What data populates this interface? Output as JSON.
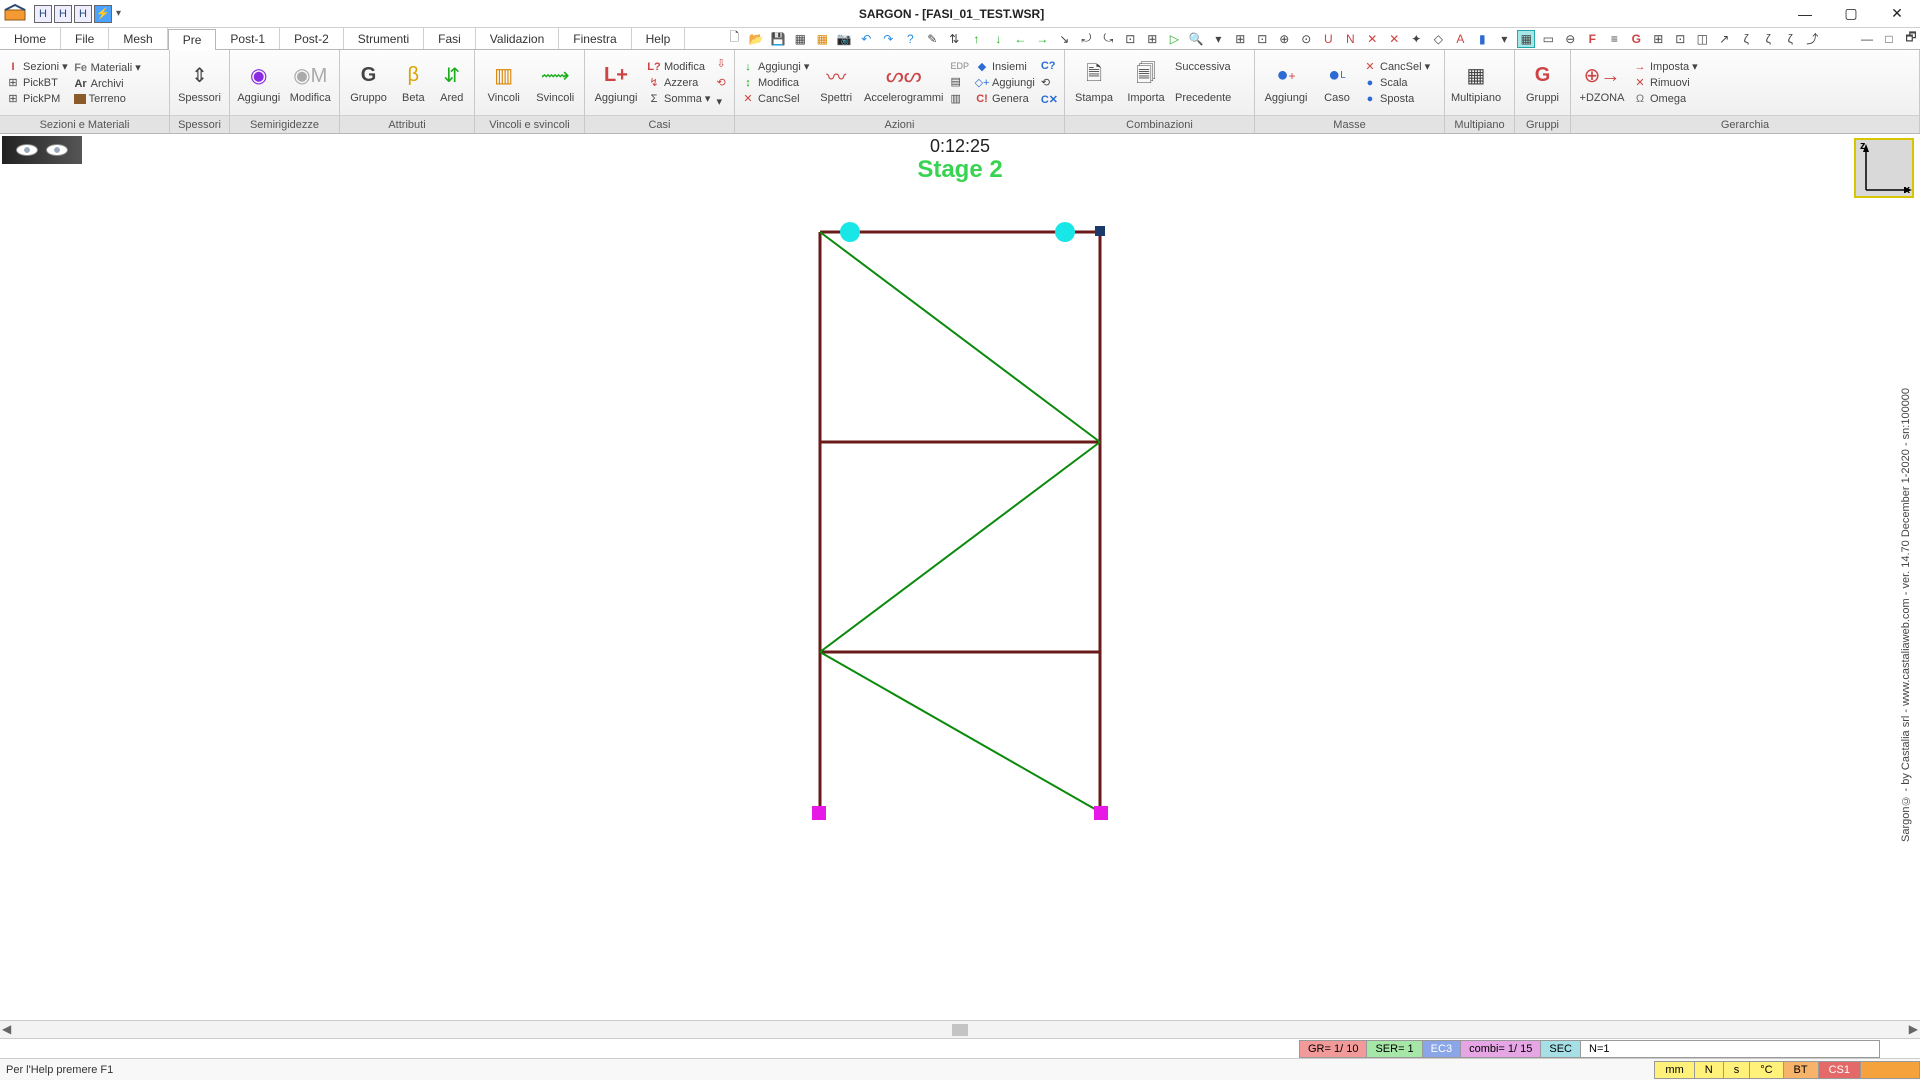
{
  "title": "SARGON - [FASI_01_TEST.WSR]",
  "qat": [
    "H",
    "H",
    "H",
    "⚡",
    "▾"
  ],
  "menus": [
    "Home",
    "File",
    "Mesh",
    "Pre",
    "Post-1",
    "Post-2",
    "Strumenti",
    "Fasi",
    "Validazion",
    "Finestra",
    "Help"
  ],
  "menu_active": "Pre",
  "ribbon": {
    "g1": {
      "label": "Sezioni e Materiali",
      "sezioni": "Sezioni",
      "materiali": "Materiali",
      "pickbt": "PickBT",
      "archivi": "Archivi",
      "pickpm": "PickPM",
      "terreno": "Terreno",
      "sez_pre": "I",
      "mat_pre": "Fe",
      "arc_pre": "Ar"
    },
    "g2": {
      "label": "Spessori",
      "btn": "Spessori"
    },
    "g3": {
      "label": "Semirigidezze",
      "aggiungi": "Aggiungi",
      "modifica": "Modifica"
    },
    "g4": {
      "label": "Attributi",
      "gruppo": "Gruppo",
      "beta": "Beta",
      "ared": "Ared"
    },
    "g5": {
      "label": "Vincoli e svincoli",
      "vincoli": "Vincoli",
      "svincoli": "Svincoli"
    },
    "g6": {
      "label": "Casi",
      "aggiungi": "Aggiungi",
      "modifica": "Modifica",
      "azzera": "Azzera",
      "somma": "Somma",
      "l_q": "L?",
      "sigma": "Σ"
    },
    "g7": {
      "label": "Azioni",
      "aggiungi": "Aggiungi",
      "modifica": "Modifica",
      "cancsel": "CancSel",
      "spettri": "Spettri",
      "accel": "Accelerogrammi",
      "insiemi": "Insiemi",
      "aggiungi2": "Aggiungi",
      "genera": "Genera",
      "edp": "EDP",
      "c_q": "C?",
      "c_bang": "C!",
      "c_cross": "C✕"
    },
    "g8": {
      "label": "Combinazioni",
      "stampa": "Stampa",
      "importa": "Importa",
      "succ": "Successiva",
      "prec": "Precedente"
    },
    "g9": {
      "label": "Masse",
      "aggiungi": "Aggiungi",
      "caso": "Caso",
      "cancsel": "CancSel",
      "scala": "Scala",
      "sposta": "Sposta"
    },
    "g10": {
      "label": "Multipiano",
      "btn": "Multipiano"
    },
    "g11": {
      "label": "Gruppi",
      "btn": "Gruppi"
    },
    "g12": {
      "label": "Gerarchia",
      "dzona": "+DZONA",
      "imposta": "Imposta",
      "rimuovi": "Rimuovi",
      "omega": "Omega"
    }
  },
  "toolbar_icons": [
    "🗋",
    "📂",
    "💾",
    "▦",
    "▦",
    "📷",
    "↶",
    "↷",
    "?",
    "✎",
    "⇅",
    "↑",
    "↓",
    "←",
    "→",
    "↘",
    "⤾",
    "⤿",
    "⊡",
    "⊞",
    "▷",
    "🔍",
    "▾",
    "⊞",
    "⊡",
    "⊕",
    "⊙",
    "U",
    "N",
    "✕",
    "✕",
    "✦",
    "◇",
    "A",
    "▮",
    "▾",
    " ",
    "▦",
    "▭",
    "⊖",
    "F",
    "≡",
    "G",
    "⊞",
    "⊡",
    "◫",
    "↗",
    "ζ",
    "ζ",
    "ζ",
    "⤴",
    " ",
    "—",
    "□",
    "🗗"
  ],
  "timer": "0:12:25",
  "stage": "Stage 2",
  "axis": {
    "z": "z",
    "x": "x"
  },
  "copyright": "Sargon© - by Castalia srl - www.castaliaweb.com - ver. 14.70 December 1-2020 - sn:100000",
  "status1": {
    "gr": "GR=  1/ 10",
    "ser": "SER= 1",
    "ec3": "EC3",
    "combi": "combi=    1/  15",
    "sec": "SEC",
    "n": "N=1"
  },
  "status2": {
    "help": "Per l'Help premere F1",
    "mm": "mm",
    "N": "N",
    "s": "s",
    "C": "°C",
    "BT": "BT",
    "CS1": "CS1"
  }
}
